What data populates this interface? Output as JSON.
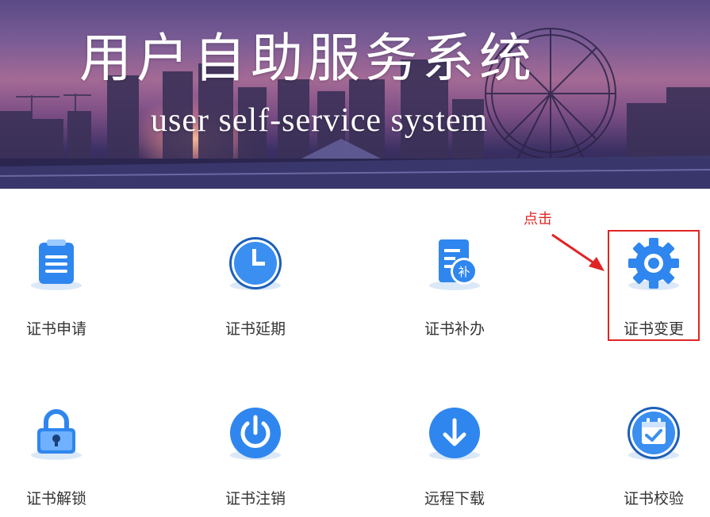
{
  "banner": {
    "title": "用户自助服务系统",
    "subtitle": "user self-service system"
  },
  "tiles": [
    {
      "label": "证书申请",
      "icon": "clipboard-list-icon"
    },
    {
      "label": "证书延期",
      "icon": "clock-icon"
    },
    {
      "label": "证书补办",
      "icon": "document-reissue-icon"
    },
    {
      "label": "证书变更",
      "icon": "gear-icon"
    },
    {
      "label": "证书解锁",
      "icon": "padlock-icon"
    },
    {
      "label": "证书注销",
      "icon": "power-icon"
    },
    {
      "label": "远程下载",
      "icon": "download-icon"
    },
    {
      "label": "证书校验",
      "icon": "calendar-check-icon"
    }
  ],
  "annotation": {
    "text": "点击",
    "color": "#e02424"
  },
  "colors": {
    "accent": "#2f86ee",
    "accent_light": "#6fb1ff",
    "shadow": "#dbe8f7"
  }
}
